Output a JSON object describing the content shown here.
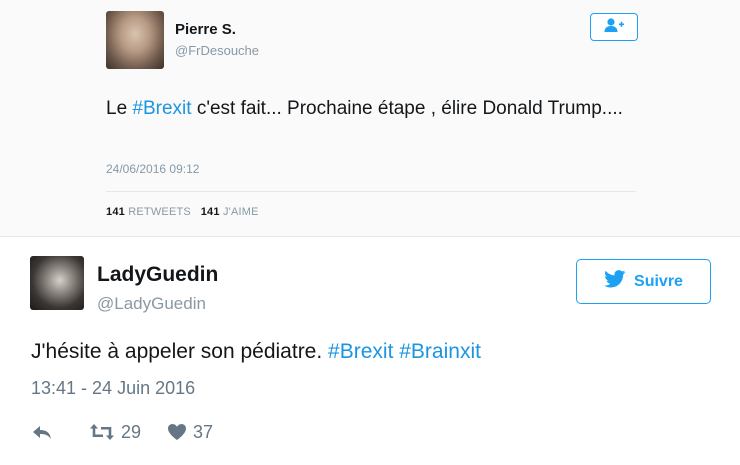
{
  "tweet_embedded": {
    "author_name": "Pierre S.",
    "author_handle": "@FrDesouche",
    "text_before": "Le ",
    "hashtag": "#Brexit",
    "text_after": " c'est fait... Prochaine étape , élire Donald Trump....",
    "date": "24/06/2016 09:12",
    "retweets_count": "141",
    "retweets_label": "RETWEETS",
    "likes_count": "141",
    "likes_label": "J'AIME",
    "follow_icon": "add-user-icon"
  },
  "tweet_main": {
    "author_name": "LadyGuedin",
    "author_handle": "@LadyGuedin",
    "follow_label": "Suivre",
    "text_before": "J'hésite à appeler son pédiatre. ",
    "hashtag1": "#Brexit",
    "hashtag2": "#Brainxit",
    "date": "13:41 - 24 Juin 2016",
    "retweets": "29",
    "likes": "37",
    "icons": [
      "reply-icon",
      "retweet-icon",
      "heart-icon",
      "twitter-bird-icon"
    ]
  },
  "colors": {
    "accent": "#1da1f2",
    "hashtag": "#1b95e0",
    "muted": "#8899a6"
  }
}
